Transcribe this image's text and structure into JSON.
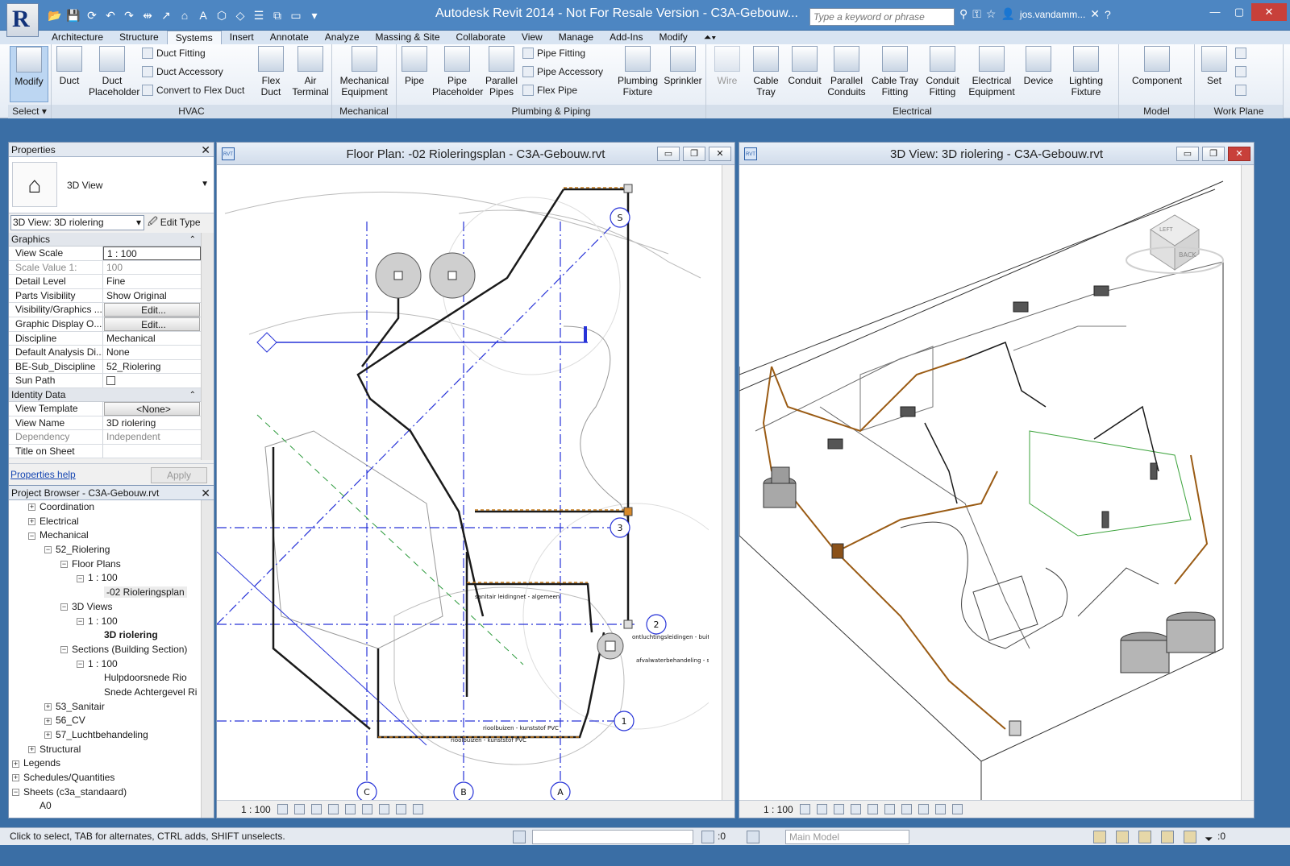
{
  "app": {
    "title": "Autodesk Revit 2014 - Not For Resale Version -      C3A-Gebouw...",
    "logo_letter": "R",
    "search_placeholder": "Type a keyword or phrase",
    "user": "jos.vandamm..."
  },
  "tabs": [
    "Architecture",
    "Structure",
    "Systems",
    "Insert",
    "Annotate",
    "Analyze",
    "Massing & Site",
    "Collaborate",
    "View",
    "Manage",
    "Add-Ins",
    "Modify",
    "⏶▾"
  ],
  "active_tab": "Systems",
  "ribbon": {
    "modify": "Modify",
    "select_panel": "Select ▾",
    "hvac": {
      "title": "HVAC",
      "duct": "Duct",
      "duct_placeholder": "Duct Placeholder",
      "duct_fitting": "Duct Fitting",
      "duct_accessory": "Duct Accessory",
      "convert": "Convert to Flex Duct",
      "flex_duct": "Flex Duct",
      "air_terminal": "Air Terminal"
    },
    "mechanical": {
      "title": "Mechanical",
      "equipment": "Mechanical Equipment"
    },
    "plumbing": {
      "title": "Plumbing & Piping",
      "pipe": "Pipe",
      "pipe_placeholder": "Pipe Placeholder",
      "parallel_pipes": "Parallel Pipes",
      "pipe_fitting": "Pipe Fitting",
      "pipe_accessory": "Pipe Accessory",
      "flex_pipe": "Flex Pipe",
      "plumbing_fixture": "Plumbing Fixture",
      "sprinkler": "Sprinkler"
    },
    "electrical": {
      "title": "Electrical",
      "wire": "Wire",
      "cable_tray": "Cable Tray",
      "conduit": "Conduit",
      "parallel_conduits": "Parallel Conduits",
      "cable_tray_fitting": "Cable Tray Fitting",
      "conduit_fitting": "Conduit Fitting",
      "electrical_equipment": "Electrical Equipment",
      "device": "Device",
      "lighting_fixture": "Lighting Fixture"
    },
    "model": {
      "title": "Model",
      "component": "Component"
    },
    "work_plane": {
      "title": "Work Plane",
      "set": "Set"
    }
  },
  "properties": {
    "title": "Properties",
    "type_name": "3D View",
    "instance": "3D View: 3D riolering",
    "edit_type": "Edit Type",
    "sections": {
      "graphics": "Graphics",
      "identity": "Identity Data"
    },
    "graphics_rows": [
      {
        "k": "View Scale",
        "v": "1 : 100"
      },
      {
        "k": "Scale Value    1:",
        "v": "100"
      },
      {
        "k": "Detail Level",
        "v": "Fine"
      },
      {
        "k": "Parts Visibility",
        "v": "Show Original"
      },
      {
        "k": "Visibility/Graphics ...",
        "v": "Edit..."
      },
      {
        "k": "Graphic Display O...",
        "v": "Edit..."
      },
      {
        "k": "Discipline",
        "v": "Mechanical"
      },
      {
        "k": "Default Analysis Di...",
        "v": "None"
      },
      {
        "k": "BE-Sub_Discipline",
        "v": "52_Riolering"
      },
      {
        "k": "Sun Path",
        "v": ""
      }
    ],
    "identity_rows": [
      {
        "k": "View Template",
        "v": "<None>"
      },
      {
        "k": "View Name",
        "v": "3D riolering"
      },
      {
        "k": "Dependency",
        "v": "Independent"
      },
      {
        "k": "Title on Sheet",
        "v": ""
      }
    ],
    "help_link": "Properties help",
    "apply": "Apply"
  },
  "browser": {
    "title": "Project Browser - C3A-Gebouw.rvt",
    "nodes": [
      {
        "t": "Coordination",
        "d": 1,
        "tog": "+"
      },
      {
        "t": "Electrical",
        "d": 1,
        "tog": "+"
      },
      {
        "t": "Mechanical",
        "d": 1,
        "tog": "−"
      },
      {
        "t": "52_Riolering",
        "d": 2,
        "tog": "−"
      },
      {
        "t": "Floor Plans",
        "d": 3,
        "tog": "−"
      },
      {
        "t": "1 : 100",
        "d": 4,
        "tog": "−"
      },
      {
        "t": "-02 Rioleringsplan",
        "d": 5,
        "tog": "",
        "sel": true
      },
      {
        "t": "3D Views",
        "d": 3,
        "tog": "−"
      },
      {
        "t": "1 : 100",
        "d": 4,
        "tog": "−"
      },
      {
        "t": "3D riolering",
        "d": 5,
        "tog": "",
        "bold": true
      },
      {
        "t": "Sections (Building Section)",
        "d": 3,
        "tog": "−"
      },
      {
        "t": "1 : 100",
        "d": 4,
        "tog": "−"
      },
      {
        "t": "Hulpdoorsnede Rio",
        "d": 5,
        "tog": ""
      },
      {
        "t": "Snede Achtergevel Ri",
        "d": 5,
        "tog": ""
      },
      {
        "t": "53_Sanitair",
        "d": 2,
        "tog": "+"
      },
      {
        "t": "56_CV",
        "d": 2,
        "tog": "+"
      },
      {
        "t": "57_Luchtbehandeling",
        "d": 2,
        "tog": "+"
      },
      {
        "t": "Structural",
        "d": 1,
        "tog": "+"
      },
      {
        "t": "Legends",
        "d": 0,
        "tog": "+"
      },
      {
        "t": "Schedules/Quantities",
        "d": 0,
        "tog": "+"
      },
      {
        "t": "Sheets (c3a_standaard)",
        "d": 0,
        "tog": "−"
      },
      {
        "t": "A0",
        "d": 1,
        "tog": ""
      }
    ]
  },
  "floorplan": {
    "title": "Floor Plan: -02 Rioleringsplan - C3A-Gebouw.rvt",
    "scale": "1 : 100",
    "grid_labels": [
      "S",
      "3",
      "2",
      "1",
      "C",
      "B",
      "A"
    ],
    "annotations": [
      "sanitair leidingnet - algemeen",
      "ontluchtingsleidingen - buitenom",
      "afvalwaterbehandeling - septic",
      "rioolbuizen - kunststof PVC",
      "rioolbuizen - kunststof PVC"
    ]
  },
  "view3d": {
    "title": "3D View: 3D riolering - C3A-Gebouw.rvt",
    "scale": "1 : 100",
    "viewcube_left": "LEFT",
    "viewcube_back": "BACK"
  },
  "status": {
    "text": "Click to select, TAB for alternates, CTRL adds, SHIFT unselects.",
    "zero1": ":0",
    "model": "Main Model",
    "zero2": ":0"
  }
}
